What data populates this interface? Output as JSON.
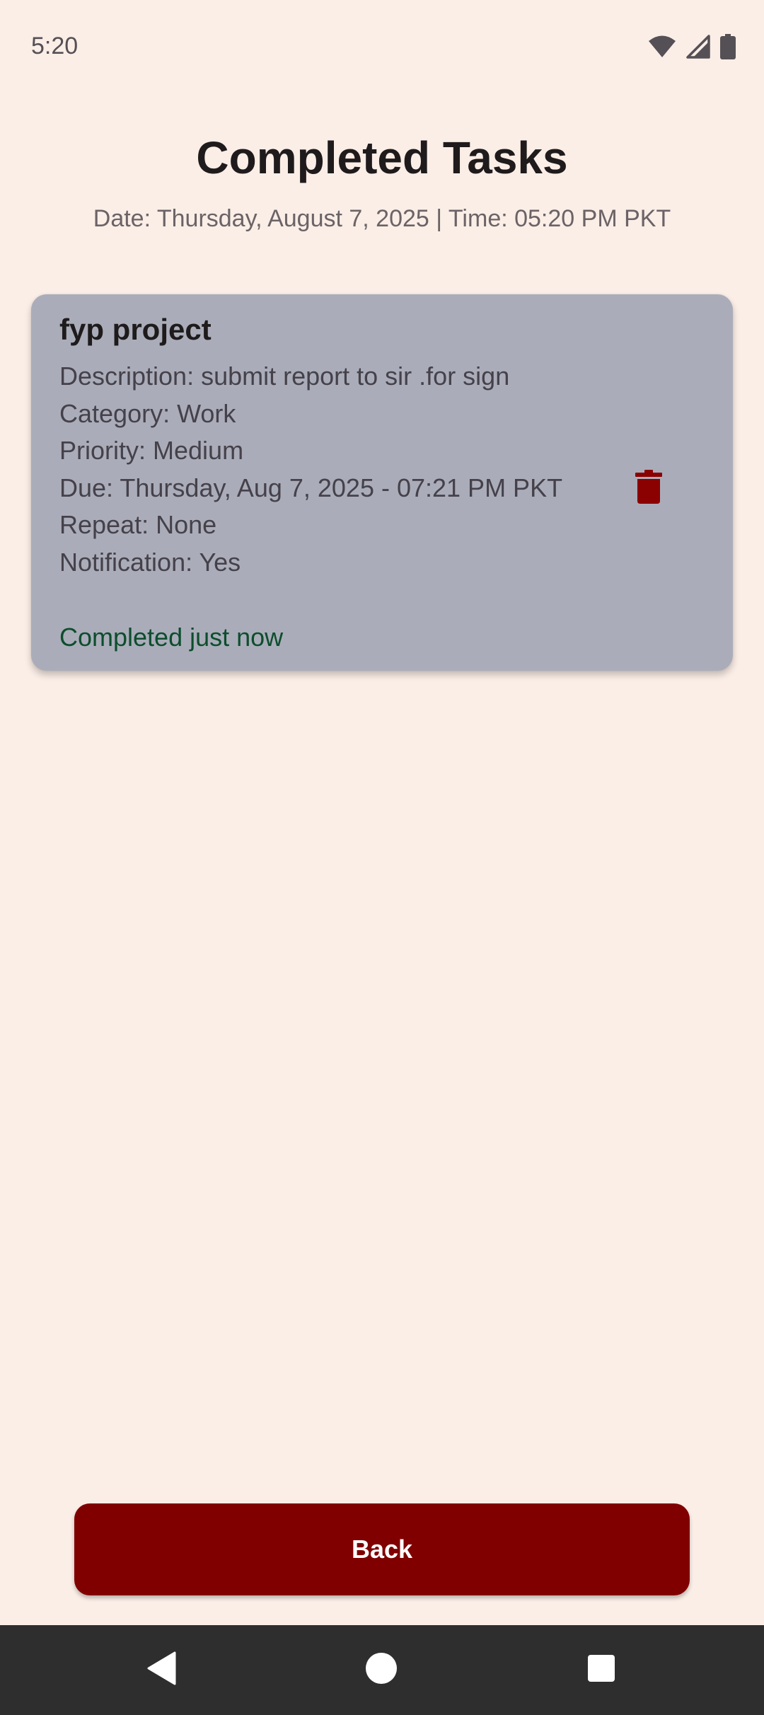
{
  "status_bar": {
    "time": "5:20",
    "icons": [
      "wifi-icon",
      "cell-signal-icon",
      "battery-icon"
    ]
  },
  "header": {
    "title": "Completed Tasks",
    "subtitle": "Date: Thursday, August 7, 2025 | Time: 05:20 PM PKT"
  },
  "tasks": [
    {
      "title": "fyp project",
      "description": "Description: submit report to sir .for sign",
      "category": "Category: Work",
      "priority": "Priority: Medium",
      "due": "Due: Thursday, Aug 7, 2025 - 07:21 PM PKT",
      "repeat": "Repeat: None",
      "notification": "Notification: Yes",
      "completed": "Completed just now",
      "delete_icon": "trash-icon"
    }
  ],
  "footer": {
    "back_label": "Back"
  },
  "nav_bar": {
    "icons": [
      "back-triangle-icon",
      "home-circle-icon",
      "recents-square-icon"
    ]
  },
  "colors": {
    "background": "#fbeee7",
    "card": "#aaadb9",
    "accent": "#800000",
    "completed_text": "#0d4d2d",
    "nav_bar": "#2e2e2e"
  }
}
